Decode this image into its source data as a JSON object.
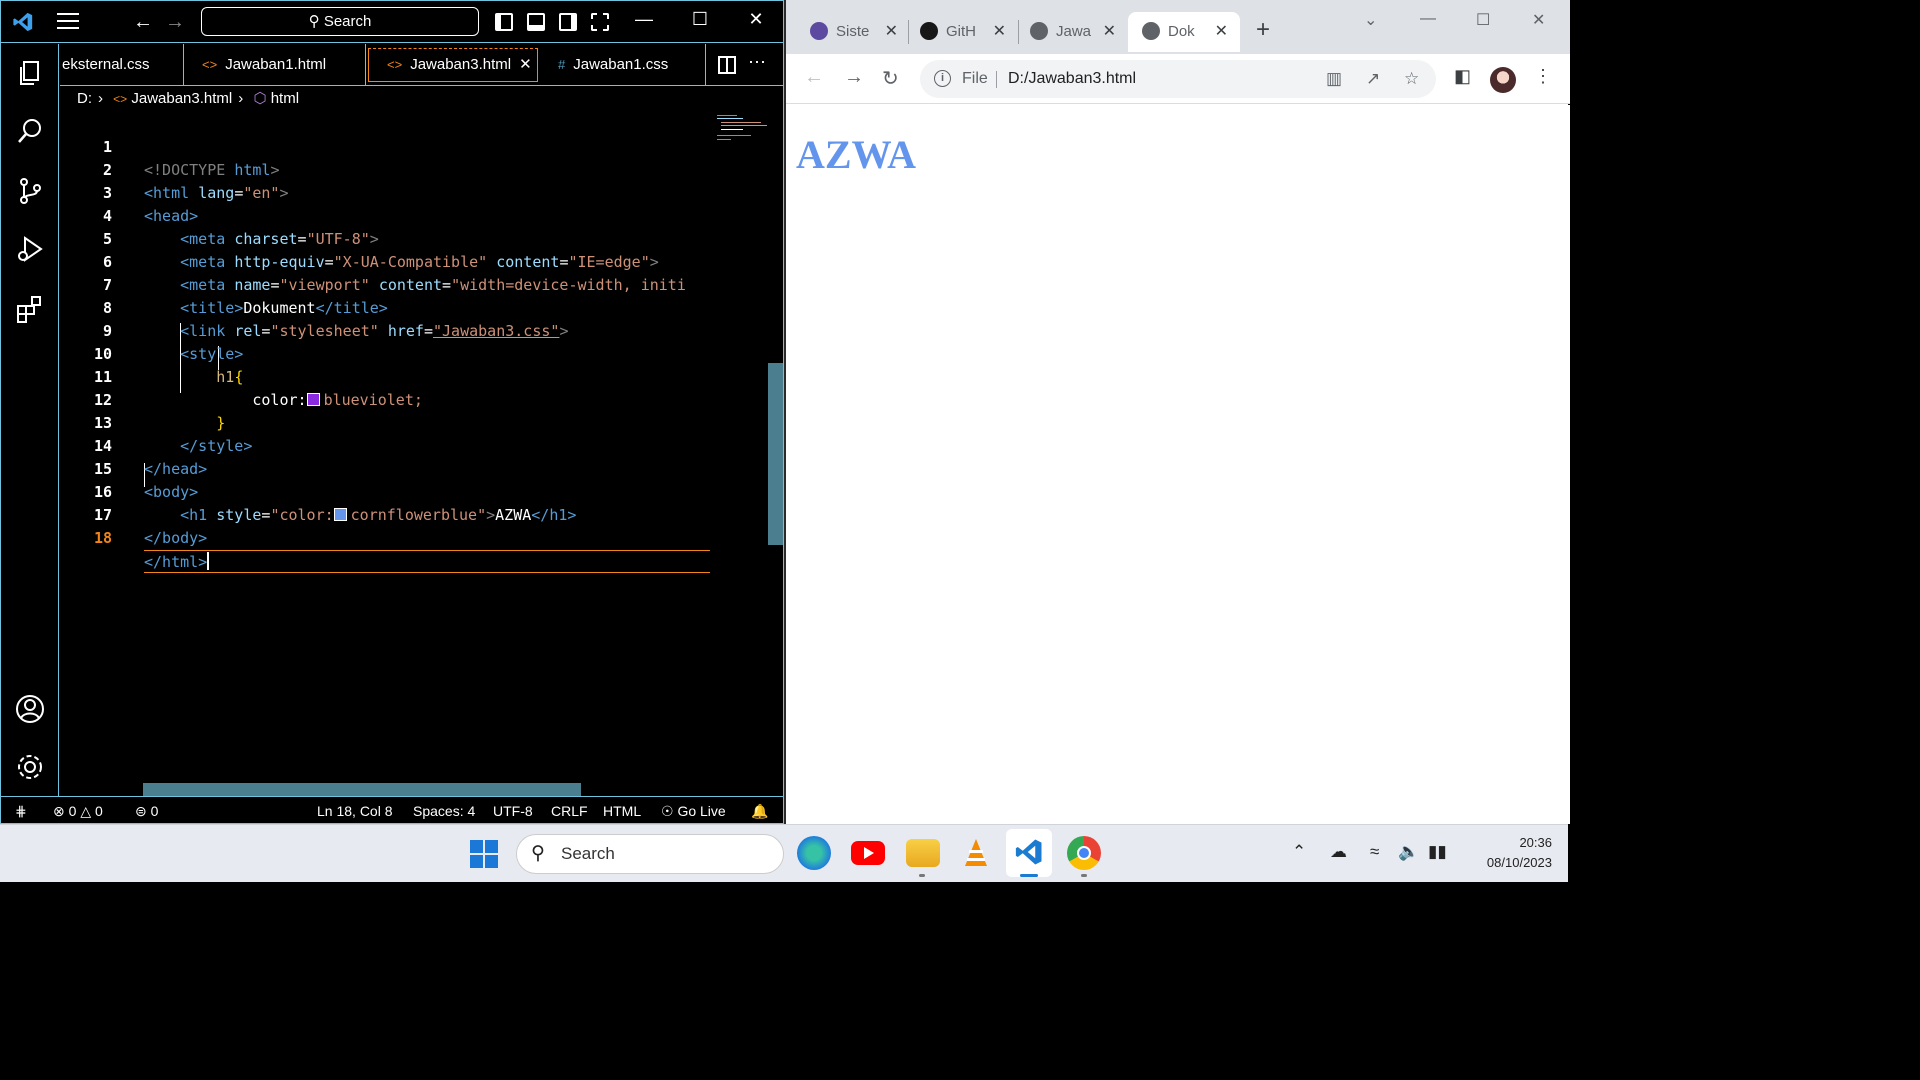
{
  "vscode": {
    "search_label": "Search",
    "tabs": [
      {
        "label": "eksternal.css",
        "icon": "css-file-icon"
      },
      {
        "label": "Jawaban1.html",
        "icon": "html-file-icon"
      },
      {
        "label": "Jawaban3.html",
        "icon": "html-file-icon",
        "active": true
      },
      {
        "label": "Jawaban1.css",
        "icon": "css-file-icon"
      }
    ],
    "breadcrumb": {
      "drive": "D:",
      "file": "Jawaban3.html",
      "symbol": "html"
    },
    "line_numbers": [
      "1",
      "2",
      "3",
      "4",
      "5",
      "6",
      "7",
      "8",
      "9",
      "10",
      "11",
      "12",
      "13",
      "14",
      "15",
      "16",
      "17",
      "18"
    ],
    "current_line": "18",
    "code": {
      "l1_doctype": "<!DOCTYPE",
      "l1_html": "html",
      "l2_tag": "<html",
      "l2_attr": "lang",
      "l2_val": "\"en\"",
      "l3": "<head>",
      "l4_tag": "<meta",
      "l4_attr": "charset",
      "l4_val": "\"UTF-8\"",
      "l5_tag": "<meta",
      "l5_attr1": "http-equiv",
      "l5_val1": "\"X-UA-Compatible\"",
      "l5_attr2": "content",
      "l5_val2": "\"IE=edge\"",
      "l6_tag": "<meta",
      "l6_attr1": "name",
      "l6_val1": "\"viewport\"",
      "l6_attr2": "content",
      "l6_val2": "\"width=device-width, initi",
      "l7_open": "<title>",
      "l7_text": "Dokument",
      "l7_close": "</title>",
      "l8_tag": "<link",
      "l8_attr1": "rel",
      "l8_val1": "\"stylesheet\"",
      "l8_attr2": "href",
      "l8_val2": "\"Jawaban3.css\"",
      "l9": "<style>",
      "l10_sel": "h1",
      "l10_brace": "{",
      "l11_prop": "color:",
      "l11_val": "blueviolet;",
      "l12_brace": "}",
      "l13": "</style>",
      "l14": "</head>",
      "l15": "<body>",
      "l16_tag": "<h1",
      "l16_attr": "style",
      "l16_val1": "\"color:",
      "l16_val2": "cornflowerblue\"",
      "l16_text": "AZWA",
      "l16_close": "</h1>",
      "l17": "</body>",
      "l18": "</html>"
    },
    "status": {
      "errors": "0",
      "warnings": "0",
      "ports": "0",
      "position": "Ln 18, Col 8",
      "spaces": "Spaces: 4",
      "encoding": "UTF-8",
      "eol": "CRLF",
      "language": "HTML",
      "golive": "Go Live"
    },
    "colors": {
      "border": "#6fc3df",
      "accent": "#f38518",
      "blueviolet": "#8a2be2",
      "cornflowerblue": "#6495ed"
    }
  },
  "chrome": {
    "tabs": [
      {
        "label": "Siste",
        "icon": "site-favicon"
      },
      {
        "label": "GitH",
        "icon": "github-icon"
      },
      {
        "label": "Jawa",
        "icon": "globe-icon"
      },
      {
        "label": "Dok",
        "icon": "globe-icon",
        "active": true
      }
    ],
    "omnibox": {
      "scheme": "File",
      "url": "D:/Jawaban3.html"
    },
    "page": {
      "heading": "AZWA",
      "heading_color": "#6495ed"
    }
  },
  "taskbar": {
    "search_label": "Search",
    "time": "20:36",
    "date": "08/10/2023"
  }
}
